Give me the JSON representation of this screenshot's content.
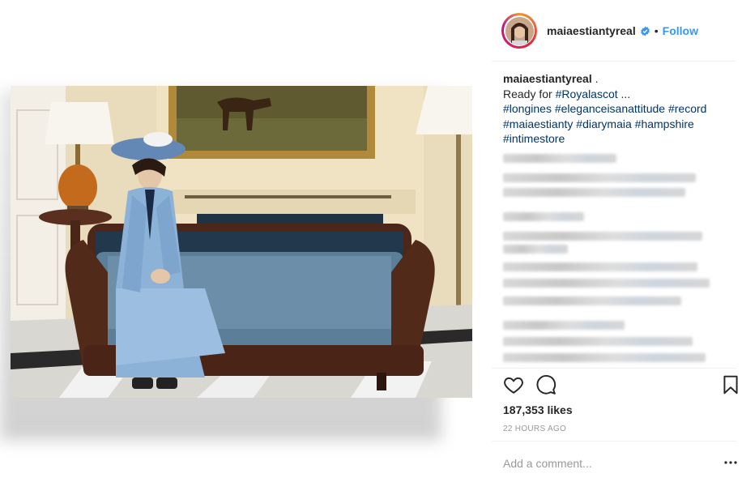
{
  "post": {
    "username": "maiaestiantyreal",
    "follow_label": "Follow",
    "header_dot": "•",
    "caption": {
      "username": "maiaestiantyreal",
      "after_username": " .",
      "line1_prefix": "Ready for ",
      "line1_tag": "#Royalascot",
      "line1_suffix": " ...",
      "hashtags": [
        "#longines",
        "#eleganceisanattitude",
        "#record",
        "#maiaestianty",
        "#diarymaia",
        "#hampshire",
        "#intimestore"
      ]
    },
    "likes": "187,353 likes",
    "timestamp": "22 HOURS AGO",
    "comment_placeholder": "Add a comment..."
  },
  "icons": {
    "verified": "verified-badge-icon",
    "like": "heart-icon",
    "comment": "comment-bubble-icon",
    "save": "bookmark-icon",
    "more": "more-options-icon"
  },
  "colors": {
    "link": "#003569",
    "follow": "#3897f0",
    "muted": "#999999"
  }
}
